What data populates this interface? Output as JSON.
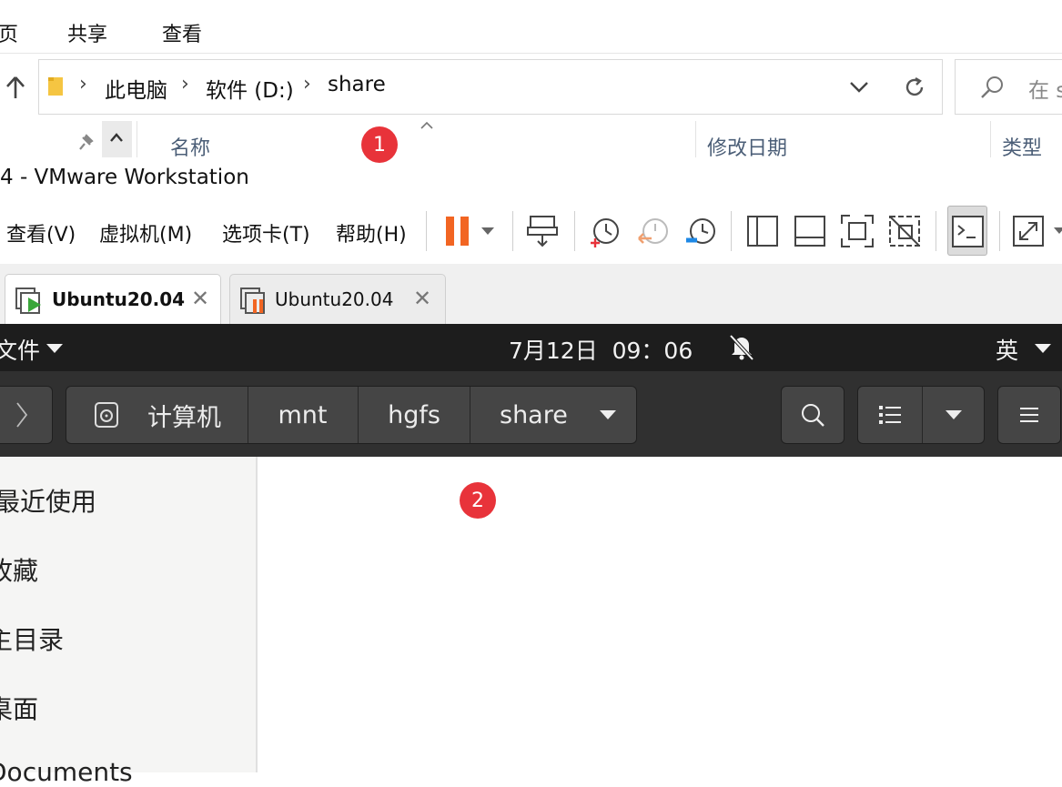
{
  "explorer": {
    "ribbon_tabs": [
      "页",
      "共享",
      "查看"
    ],
    "breadcrumb": [
      "此电脑",
      "软件 (D:)",
      "share"
    ],
    "search_placeholder": "在 s",
    "columns": {
      "name": "名称",
      "modified": "修改日期",
      "type": "类型"
    }
  },
  "vmware": {
    "title": "4 - VMware Workstation",
    "menu": [
      "查看(V)",
      "虚拟机(M)",
      "选项卡(T)",
      "帮助(H)"
    ],
    "tabs": [
      {
        "label": "Ubuntu20.04",
        "active": true
      },
      {
        "label": "Ubuntu20.04",
        "active": false
      }
    ]
  },
  "ubuntu": {
    "app_menu": "文件",
    "clock": "7月12日  09：06",
    "input_method": "英"
  },
  "nautilus": {
    "path": [
      "计算机",
      "mnt",
      "hgfs",
      "share"
    ],
    "sidebar": [
      "最近使用",
      "收藏",
      "主目录",
      "桌面",
      "Documents"
    ]
  },
  "annotations": {
    "marker1": "1",
    "marker2": "2"
  },
  "colors": {
    "accent_orange": "#f26522",
    "marker_red": "#e8333a",
    "vm_green": "#3aa63a"
  }
}
